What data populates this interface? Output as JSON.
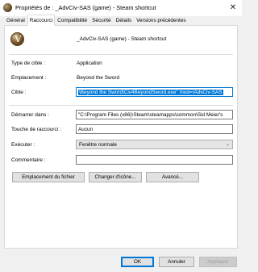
{
  "window": {
    "title": "Propriétés de : _AdvCiv-SAS (game) - Steam shortcut",
    "app_icon": "civ-icon",
    "close_glyph": "✕"
  },
  "tabs": [
    {
      "label": "Général",
      "active": false
    },
    {
      "label": "Raccourci",
      "active": true
    },
    {
      "label": "Compatibilité",
      "active": false
    },
    {
      "label": "Sécurité",
      "active": false
    },
    {
      "label": "Détails",
      "active": false
    },
    {
      "label": "Versions précédentes",
      "active": false
    }
  ],
  "shortcut": {
    "icon_glyph": "V",
    "name": "_AdvCiv-SAS (game) - Steam shortcut",
    "target_type_label": "Type de cible :",
    "target_type_value": "Application",
    "location_label": "Emplacement :",
    "location_value": "Beyond the Sword",
    "target_label": "Cible :",
    "target_value": "\\Beyond the Sword\\Civ4BeyondSword.exe\" mod=\\AdvCiv-SAS",
    "start_in_label": "Démarrer dans :",
    "start_in_value": "\"C:\\Program Files (x86)\\Steam\\steamapps\\common\\Sid Meier's",
    "hotkey_label": "Touche de raccourci :",
    "hotkey_value": "Aucun",
    "run_label": "Exécuter :",
    "run_value": "Fenêtre normale",
    "comment_label": "Commentaire :",
    "comment_value": ""
  },
  "actions": {
    "open_location": "Emplacement du fichier",
    "change_icon": "Changer d'icône...",
    "advanced": "Avancé..."
  },
  "footer": {
    "ok": "OK",
    "cancel": "Annuler",
    "apply": "Appliquer"
  },
  "colors": {
    "accent": "#0078d7",
    "window_bg": "#f0f0f0",
    "panel_bg": "#ffffff"
  }
}
